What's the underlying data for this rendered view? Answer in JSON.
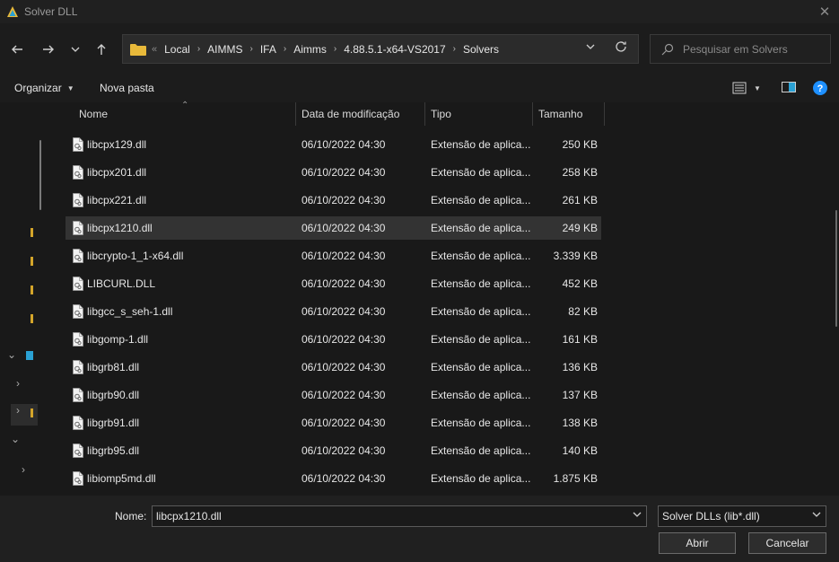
{
  "window": {
    "title": "Solver DLL",
    "close_icon": "close-icon"
  },
  "nav": {
    "breadcrumbs": [
      "Local",
      "AIMMS",
      "IFA",
      "Aimms",
      "4.88.5.1-x64-VS2017",
      "Solvers"
    ],
    "search_placeholder": "Pesquisar em Solvers"
  },
  "toolbar": {
    "organize_label": "Organizar",
    "new_folder_label": "Nova pasta"
  },
  "columns": {
    "name": "Nome",
    "date": "Data de modificação",
    "type": "Tipo",
    "size": "Tamanho"
  },
  "files": [
    {
      "name": "libcpx129.dll",
      "date": "06/10/2022 04:30",
      "type": "Extensão de aplica...",
      "size": "250 KB"
    },
    {
      "name": "libcpx201.dll",
      "date": "06/10/2022 04:30",
      "type": "Extensão de aplica...",
      "size": "258 KB"
    },
    {
      "name": "libcpx221.dll",
      "date": "06/10/2022 04:30",
      "type": "Extensão de aplica...",
      "size": "261 KB"
    },
    {
      "name": "libcpx1210.dll",
      "date": "06/10/2022 04:30",
      "type": "Extensão de aplica...",
      "size": "249 KB",
      "selected": true
    },
    {
      "name": "libcrypto-1_1-x64.dll",
      "date": "06/10/2022 04:30",
      "type": "Extensão de aplica...",
      "size": "3.339 KB"
    },
    {
      "name": "LIBCURL.DLL",
      "date": "06/10/2022 04:30",
      "type": "Extensão de aplica...",
      "size": "452 KB"
    },
    {
      "name": "libgcc_s_seh-1.dll",
      "date": "06/10/2022 04:30",
      "type": "Extensão de aplica...",
      "size": "82 KB"
    },
    {
      "name": "libgomp-1.dll",
      "date": "06/10/2022 04:30",
      "type": "Extensão de aplica...",
      "size": "161 KB"
    },
    {
      "name": "libgrb81.dll",
      "date": "06/10/2022 04:30",
      "type": "Extensão de aplica...",
      "size": "136 KB"
    },
    {
      "name": "libgrb90.dll",
      "date": "06/10/2022 04:30",
      "type": "Extensão de aplica...",
      "size": "137 KB"
    },
    {
      "name": "libgrb91.dll",
      "date": "06/10/2022 04:30",
      "type": "Extensão de aplica...",
      "size": "138 KB"
    },
    {
      "name": "libgrb95.dll",
      "date": "06/10/2022 04:30",
      "type": "Extensão de aplica...",
      "size": "140 KB"
    },
    {
      "name": "libiomp5md.dll",
      "date": "06/10/2022 04:30",
      "type": "Extensão de aplica...",
      "size": "1.875 KB"
    }
  ],
  "footer": {
    "filename_label": "Nome:",
    "filename_value": "libcpx1210.dll",
    "filter_value": "Solver DLLs (lib*.dll)",
    "open_label": "Abrir",
    "cancel_label": "Cancelar"
  },
  "colors": {
    "accent": "#0078d4",
    "folder": "#e8b93a",
    "help": "#1e90ff"
  }
}
